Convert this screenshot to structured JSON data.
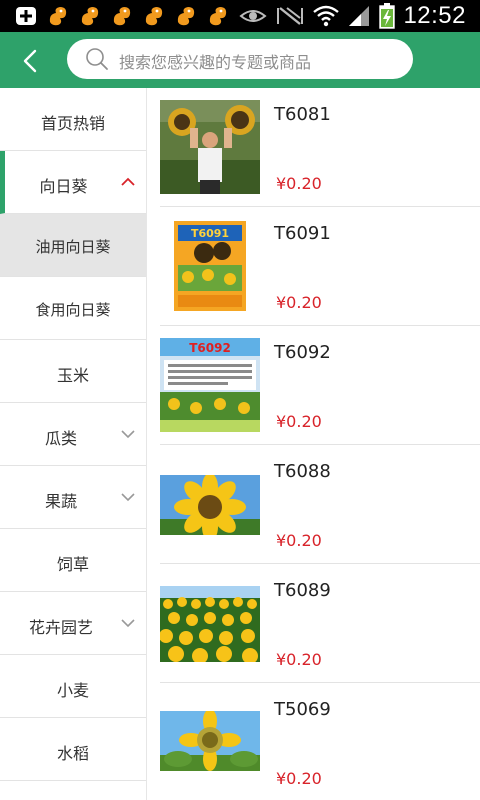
{
  "status_bar": {
    "time": "12:52",
    "notification_icons": [
      "add-box-icon",
      "squirrel-app-icon",
      "squirrel-app-icon",
      "squirrel-app-icon",
      "squirrel-app-icon",
      "squirrel-app-icon",
      "squirrel-app-icon"
    ],
    "system_icons": [
      "eye-icon",
      "no-signal-icon",
      "wifi-icon",
      "cell-signal-icon",
      "battery-charging-icon"
    ]
  },
  "header": {
    "back_icon": "back-chevron-icon",
    "search_placeholder": "搜索您感兴趣的专题或商品"
  },
  "colors": {
    "primary": "#2ea26a",
    "price": "#d8232a",
    "selected_bg": "#e5e5e5"
  },
  "sidebar": {
    "items": [
      {
        "label": "首页热销",
        "arrow": "none"
      },
      {
        "label": "向日葵",
        "arrow": "up",
        "active": true
      },
      {
        "label": "油用向日葵",
        "sub": true,
        "selected": true
      },
      {
        "label": "食用向日葵",
        "sub": true
      },
      {
        "label": "玉米",
        "arrow": "none"
      },
      {
        "label": "瓜类",
        "arrow": "down"
      },
      {
        "label": "果蔬",
        "arrow": "down"
      },
      {
        "label": "饲草",
        "arrow": "none"
      },
      {
        "label": "花卉园艺",
        "arrow": "down"
      },
      {
        "label": "小麦",
        "arrow": "none"
      },
      {
        "label": "水稻",
        "arrow": "none"
      }
    ]
  },
  "products": [
    {
      "name": "T6081",
      "price": "¥0.20",
      "thumb": "man-with-sunflower-heads-photo"
    },
    {
      "name": "T6091",
      "price": "¥0.20",
      "thumb": "seed-package-photo"
    },
    {
      "name": "T6092",
      "price": "¥0.20",
      "thumb": "seed-brochure-photo"
    },
    {
      "name": "T6088",
      "price": "¥0.20",
      "thumb": "sunflower-closeup-photo"
    },
    {
      "name": "T6089",
      "price": "¥0.20",
      "thumb": "sunflower-field-photo"
    },
    {
      "name": "T5069",
      "price": "¥0.20",
      "thumb": "sunflower-sky-photo"
    }
  ],
  "thumb_text": {
    "package_label": "T6091",
    "brochure_label": "T6092"
  }
}
